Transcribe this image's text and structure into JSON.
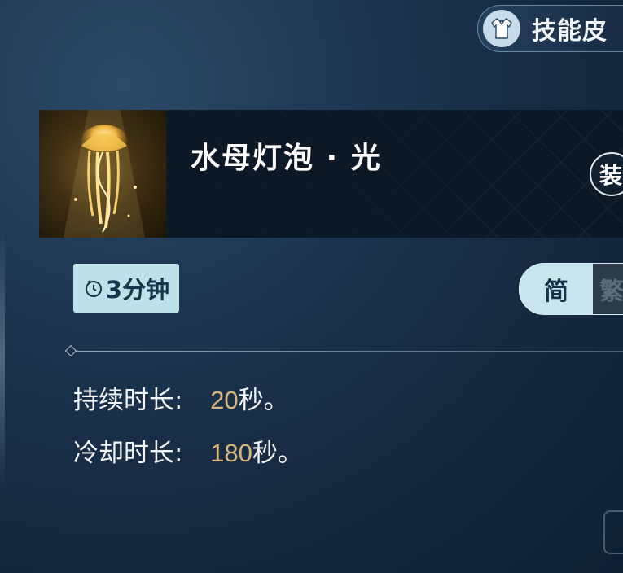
{
  "header": {
    "skin_tab_label": "技能皮",
    "skin_tab_icon": "shirt-icon"
  },
  "item": {
    "name": "水母灯泡 · 光",
    "thumbnail": "golden-jellyfish-image",
    "equip_label": "装"
  },
  "duration": {
    "icon": "timer-icon",
    "label": "3分钟"
  },
  "mode_toggle": {
    "active_label": "简",
    "inactive_label": "繁"
  },
  "stats": [
    {
      "label": "持续时长:",
      "value": "20",
      "unit": "秒。"
    },
    {
      "label": "冷却时长:",
      "value": "180",
      "unit": "秒。"
    }
  ],
  "colors": {
    "background": "#1d3550",
    "accent_value": "#d9b67a",
    "chip_bg": "#bfe2ea"
  }
}
